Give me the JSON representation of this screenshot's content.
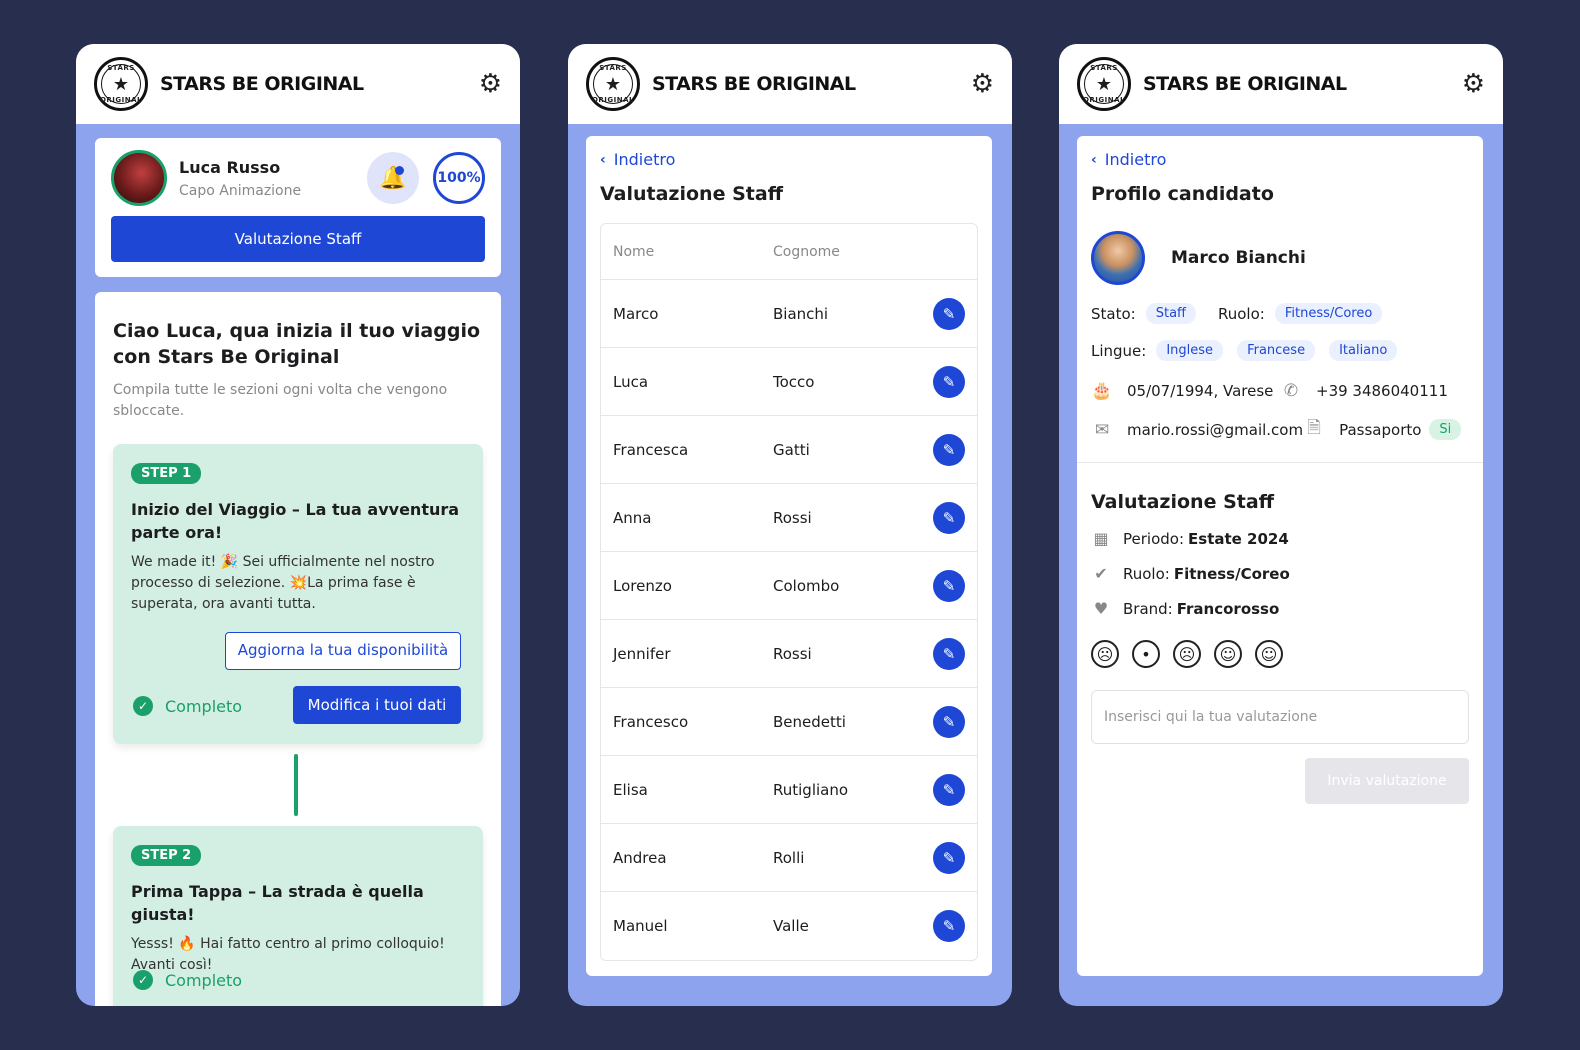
{
  "app": {
    "brand": "STARS BE ORIGINAL",
    "logo_top": "STARS",
    "logo_bottom": "ORIGINAL"
  },
  "screen1": {
    "user_name": "Luca Russo",
    "user_role": "Capo Animazione",
    "progress": "100%",
    "staff_button": "Valutazione Staff",
    "welcome_title": "Ciao Luca, qua inizia il tuo viaggio con Stars Be Original",
    "welcome_sub": "Compila tutte le sezioni ogni volta che vengono sbloccate.",
    "steps": [
      {
        "badge": "STEP 1",
        "title": "Inizio del Viaggio – La tua avventura parte ora!",
        "text": "We made it! 🎉 Sei ufficialmente nel nostro processo di selezione. 💥La prima fase è superata, ora avanti tutta.",
        "availability_button": "Aggiorna la tua disponibilità",
        "edit_button": "Modifica i tuoi dati",
        "status": "Completo"
      },
      {
        "badge": "STEP 2",
        "title": "Prima Tappa – La strada è quella giusta!",
        "text": "Yesss! 🔥 Hai fatto centro al primo colloquio! Avanti così!",
        "status": "Completo"
      }
    ]
  },
  "screen2": {
    "back": "Indietro",
    "title": "Valutazione Staff",
    "columns": [
      "Nome",
      "Cognome"
    ],
    "rows": [
      [
        "Marco",
        "Bianchi"
      ],
      [
        "Luca",
        "Tocco"
      ],
      [
        "Francesca",
        "Gatti"
      ],
      [
        "Anna",
        "Rossi"
      ],
      [
        "Lorenzo",
        "Colombo"
      ],
      [
        "Jennifer",
        "Rossi"
      ],
      [
        "Francesco",
        "Benedetti"
      ],
      [
        "Elisa",
        "Rutigliano"
      ],
      [
        "Andrea",
        "Rolli"
      ],
      [
        "Manuel",
        "Valle"
      ]
    ]
  },
  "screen3": {
    "back": "Indietro",
    "title": "Profilo candidato",
    "name": "Marco Bianchi",
    "status_label": "Stato:",
    "status_value": "Staff",
    "role_label": "Ruolo:",
    "role_value": "Fitness/Coreo",
    "languages_label": "Lingue:",
    "languages": [
      "Inglese",
      "Francese",
      "Italiano"
    ],
    "birth": "05/07/1994, Varese",
    "phone": "+39 3486040111",
    "email": "mario.rossi@gmail.com",
    "passport_label": "Passaporto",
    "passport_value": "Si",
    "eval_title": "Valutazione Staff",
    "period_label": "Periodo:",
    "period_value": "Estate 2024",
    "eval_role_label": "Ruolo:",
    "eval_role_value": "Fitness/Coreo",
    "brand_label": "Brand:",
    "brand_value": "Francorosso",
    "placeholder": "Inserisci qui la tua valutazione",
    "send_button": "Invia valutazione"
  }
}
